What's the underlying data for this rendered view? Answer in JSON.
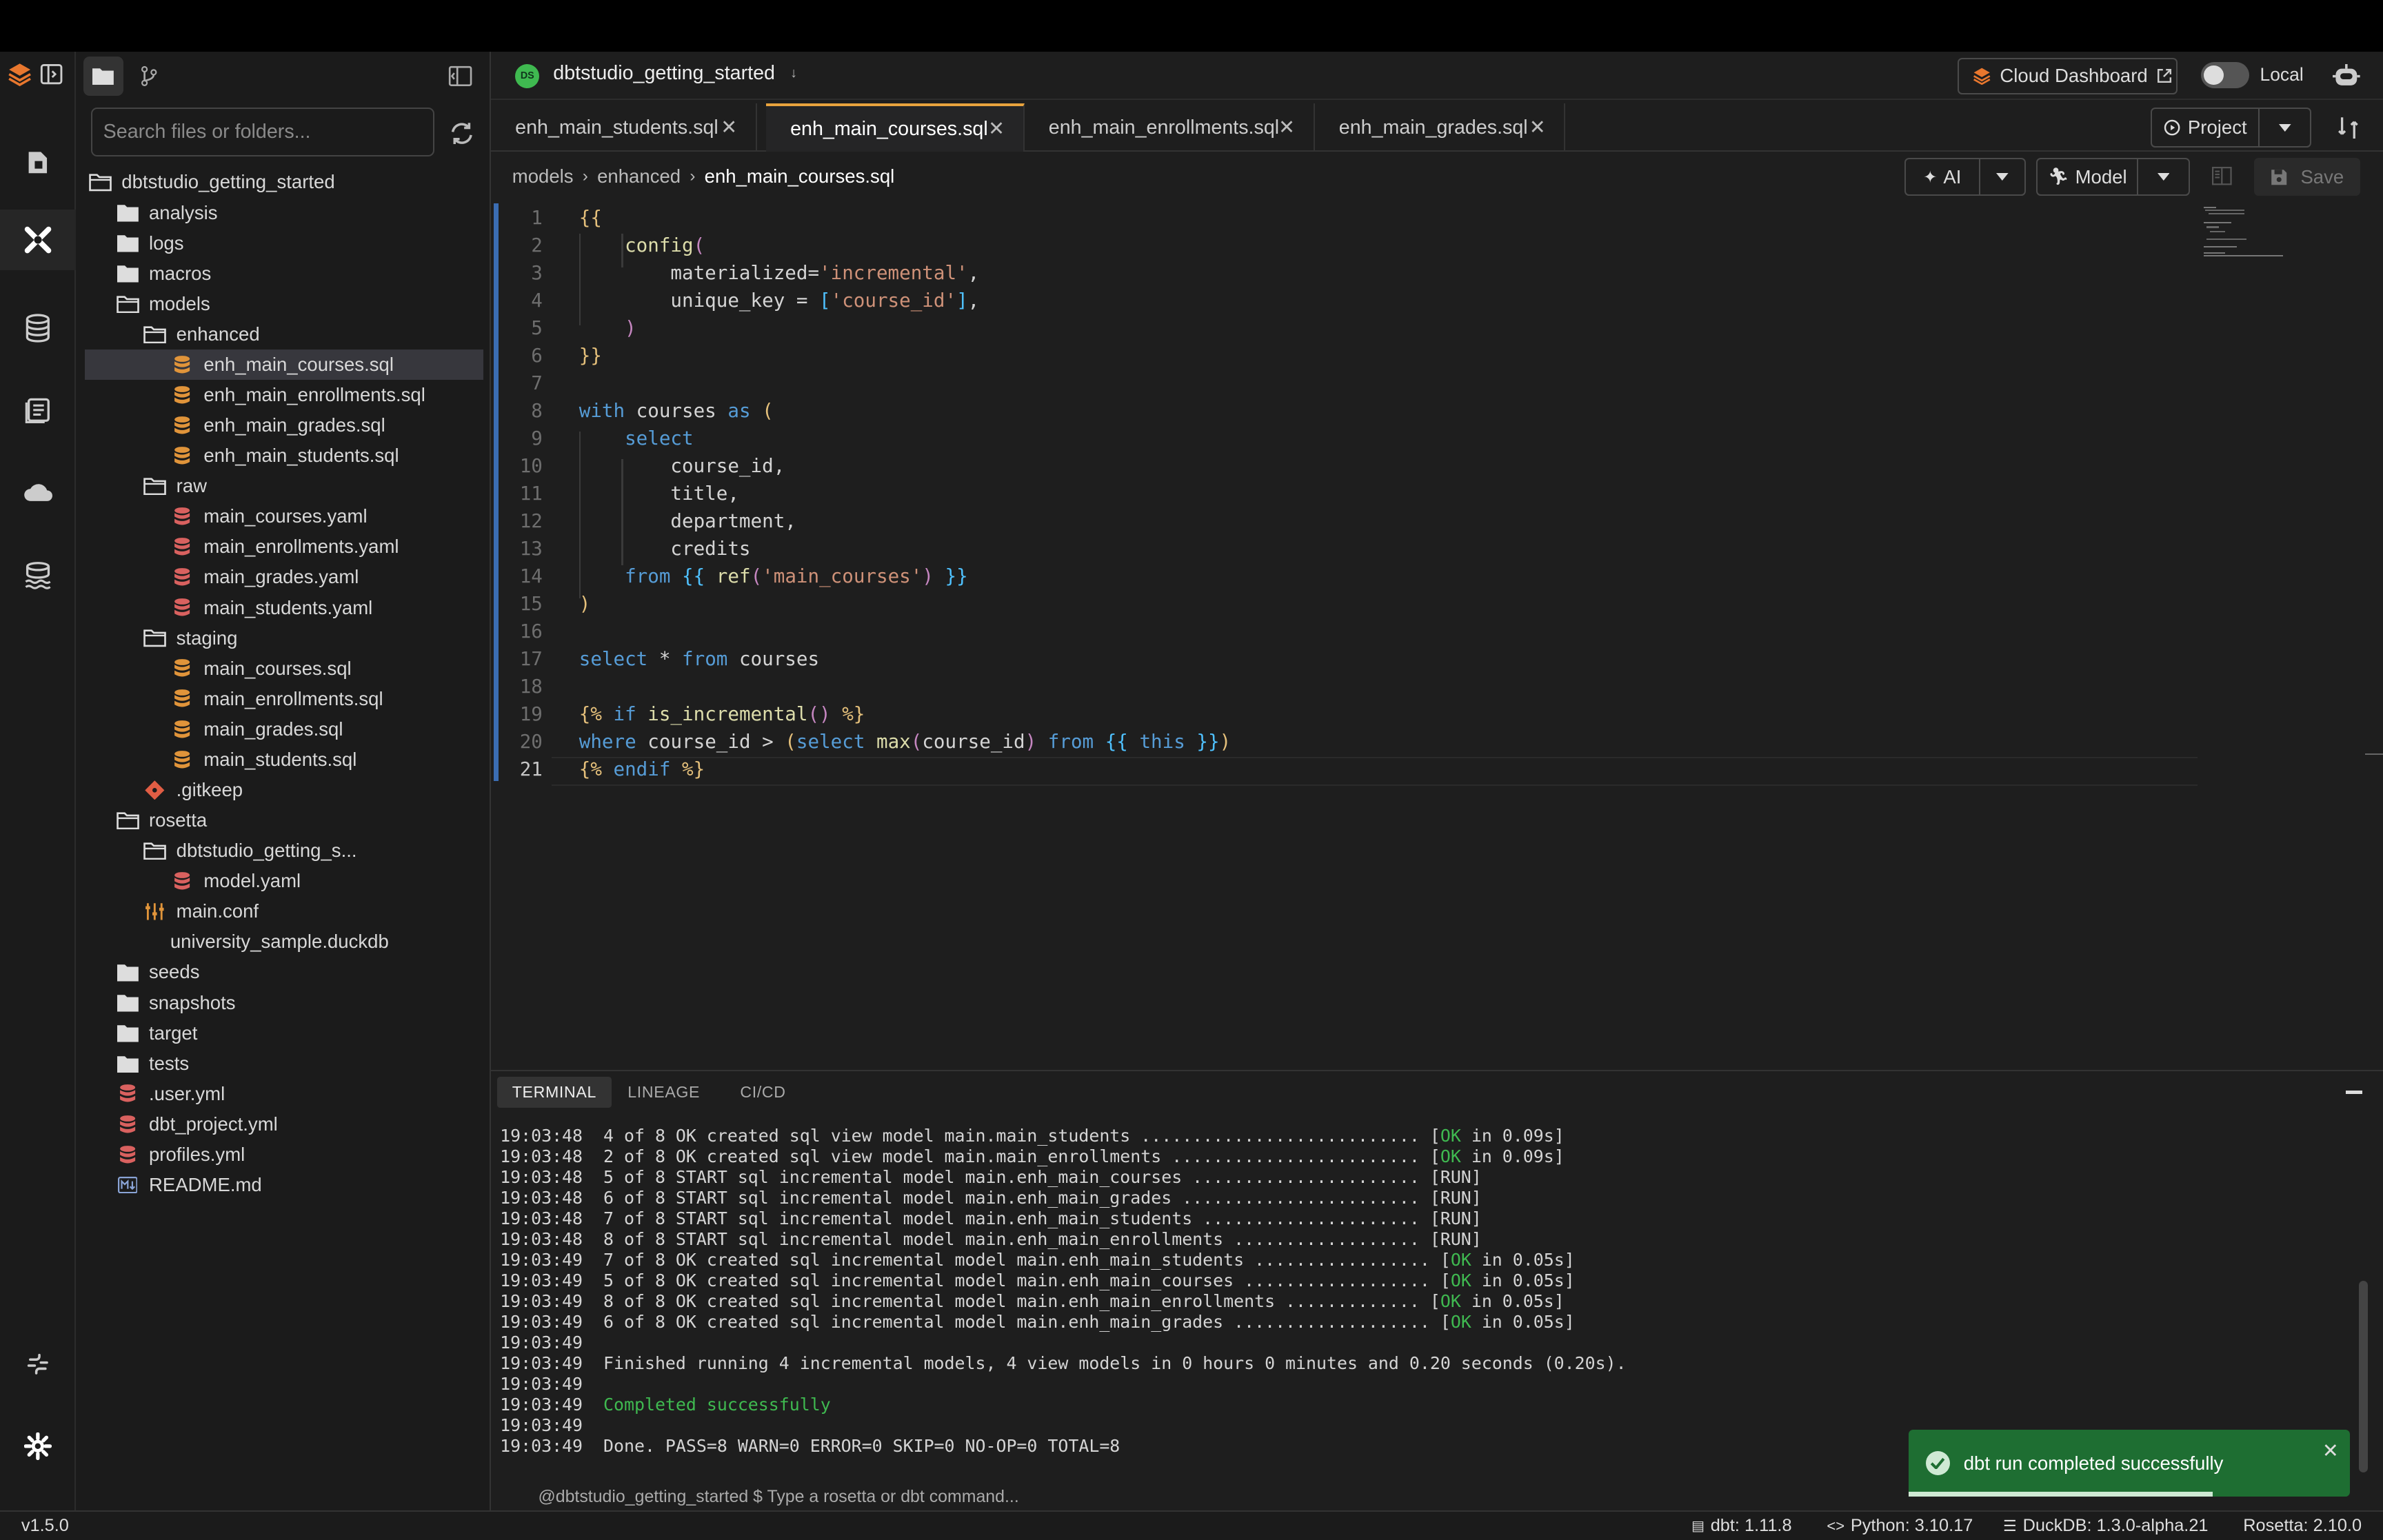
{
  "app": {
    "project_name": "dbtstudio_getting_started",
    "project_badge": "DS",
    "cloud_dashboard": "Cloud Dashboard",
    "env_toggle_label": "Local",
    "version": "v1.5.0"
  },
  "explorer": {
    "search_placeholder": "Search files or folders...",
    "tree": [
      {
        "label": "dbtstudio_getting_started",
        "type": "folder-open",
        "depth": 0
      },
      {
        "label": "analysis",
        "type": "folder",
        "depth": 1
      },
      {
        "label": "logs",
        "type": "folder",
        "depth": 1
      },
      {
        "label": "macros",
        "type": "folder",
        "depth": 1
      },
      {
        "label": "models",
        "type": "folder-open",
        "depth": 1
      },
      {
        "label": "enhanced",
        "type": "folder-open",
        "depth": 2
      },
      {
        "label": "enh_main_courses.sql",
        "type": "sql",
        "depth": 3,
        "selected": true
      },
      {
        "label": "enh_main_enrollments.sql",
        "type": "sql",
        "depth": 3
      },
      {
        "label": "enh_main_grades.sql",
        "type": "sql",
        "depth": 3
      },
      {
        "label": "enh_main_students.sql",
        "type": "sql",
        "depth": 3
      },
      {
        "label": "raw",
        "type": "folder-open",
        "depth": 2
      },
      {
        "label": "main_courses.yaml",
        "type": "yaml",
        "depth": 3
      },
      {
        "label": "main_enrollments.yaml",
        "type": "yaml",
        "depth": 3
      },
      {
        "label": "main_grades.yaml",
        "type": "yaml",
        "depth": 3
      },
      {
        "label": "main_students.yaml",
        "type": "yaml",
        "depth": 3
      },
      {
        "label": "staging",
        "type": "folder-open",
        "depth": 2
      },
      {
        "label": "main_courses.sql",
        "type": "sql",
        "depth": 3
      },
      {
        "label": "main_enrollments.sql",
        "type": "sql",
        "depth": 3
      },
      {
        "label": "main_grades.sql",
        "type": "sql",
        "depth": 3
      },
      {
        "label": "main_students.sql",
        "type": "sql",
        "depth": 3
      },
      {
        "label": ".gitkeep",
        "type": "git",
        "depth": 2
      },
      {
        "label": "rosetta",
        "type": "folder-open",
        "depth": 1
      },
      {
        "label": "dbtstudio_getting_s...",
        "type": "folder-open",
        "depth": 2
      },
      {
        "label": "model.yaml",
        "type": "yaml",
        "depth": 3
      },
      {
        "label": "main.conf",
        "type": "conf",
        "depth": 2
      },
      {
        "label": "university_sample.duckdb",
        "type": "plain",
        "depth": 2
      },
      {
        "label": "seeds",
        "type": "folder",
        "depth": 1
      },
      {
        "label": "snapshots",
        "type": "folder",
        "depth": 1
      },
      {
        "label": "target",
        "type": "folder",
        "depth": 1
      },
      {
        "label": "tests",
        "type": "folder",
        "depth": 1
      },
      {
        "label": ".user.yml",
        "type": "yaml",
        "depth": 1
      },
      {
        "label": "dbt_project.yml",
        "type": "yaml",
        "depth": 1
      },
      {
        "label": "profiles.yml",
        "type": "yaml",
        "depth": 1
      },
      {
        "label": "README.md",
        "type": "md",
        "depth": 1
      }
    ]
  },
  "tabs": [
    {
      "label": "enh_main_students.sql",
      "active": false
    },
    {
      "label": "enh_main_courses.sql",
      "active": true
    },
    {
      "label": "enh_main_enrollments.sql",
      "active": false
    },
    {
      "label": "enh_main_grades.sql",
      "active": false
    }
  ],
  "toolbar": {
    "project": "Project",
    "ai": "AI",
    "model": "Model",
    "save": "Save"
  },
  "breadcrumb": [
    "models",
    "enhanced",
    "enh_main_courses.sql"
  ],
  "editor": {
    "lines": [
      [
        [
          "{{",
          "br"
        ]
      ],
      [
        [
          "    ",
          ""
        ],
        [
          "config",
          "fn"
        ],
        [
          "(",
          "br2"
        ]
      ],
      [
        [
          "        materialized=",
          "pl"
        ],
        [
          "'incremental'",
          "st"
        ],
        [
          ",",
          "pl"
        ]
      ],
      [
        [
          "        unique_key = ",
          "pl"
        ],
        [
          "[",
          "br3"
        ],
        [
          "'course_id'",
          "st"
        ],
        [
          "]",
          "br3"
        ],
        [
          ",",
          "pl"
        ]
      ],
      [
        [
          "    ",
          ""
        ],
        [
          ")",
          "br2"
        ]
      ],
      [
        [
          "}}",
          "br"
        ]
      ],
      [],
      [
        [
          "with",
          "kw"
        ],
        [
          " courses ",
          "pl"
        ],
        [
          "as",
          "kw"
        ],
        [
          " (",
          "br"
        ]
      ],
      [
        [
          "    ",
          ""
        ],
        [
          "select",
          "kw"
        ]
      ],
      [
        [
          "        course_id,",
          "pl"
        ]
      ],
      [
        [
          "        title,",
          "pl"
        ]
      ],
      [
        [
          "        department,",
          "pl"
        ]
      ],
      [
        [
          "        credits",
          "pl"
        ]
      ],
      [
        [
          "    ",
          ""
        ],
        [
          "from",
          "kw"
        ],
        [
          " ",
          ""
        ],
        [
          "{{",
          "br3"
        ],
        [
          " ",
          ""
        ],
        [
          "ref",
          "fn"
        ],
        [
          "(",
          "br2"
        ],
        [
          "'main_courses'",
          "st"
        ],
        [
          ")",
          "br2"
        ],
        [
          " ",
          ""
        ],
        [
          "}}",
          "br3"
        ]
      ],
      [
        [
          ")",
          "br"
        ]
      ],
      [],
      [
        [
          "select",
          "kw"
        ],
        [
          " * ",
          "pl"
        ],
        [
          "from",
          "kw"
        ],
        [
          " courses",
          "pl"
        ]
      ],
      [],
      [
        [
          "{%",
          "br"
        ],
        [
          " if ",
          "kw"
        ],
        [
          "is_incremental",
          "fn"
        ],
        [
          "()",
          "br2"
        ],
        [
          " %}",
          "br"
        ]
      ],
      [
        [
          "where",
          "kw"
        ],
        [
          " course_id > ",
          "pl"
        ],
        [
          "(",
          "br"
        ],
        [
          "select",
          "kw"
        ],
        [
          " max",
          "fn"
        ],
        [
          "(",
          "br2"
        ],
        [
          "course_id",
          "pl"
        ],
        [
          ")",
          "br2"
        ],
        [
          " from ",
          "kw"
        ],
        [
          "{{",
          "br3"
        ],
        [
          " this ",
          "kw"
        ],
        [
          "}}",
          "br3"
        ],
        [
          ")",
          "br"
        ]
      ],
      [
        [
          "{%",
          "br"
        ],
        [
          " endif ",
          "kw"
        ],
        [
          "%}",
          "br"
        ]
      ]
    ]
  },
  "terminal": {
    "tabs": [
      "TERMINAL",
      "LINEAGE",
      "CI/CD"
    ],
    "lines": [
      {
        "time": "19:03:48",
        "text": "4 of 8 OK created sql view model main.main_students ........................... ",
        "status": "OK",
        "tail": " in 0.09s]"
      },
      {
        "time": "19:03:48",
        "text": "2 of 8 OK created sql view model main.main_enrollments ........................ ",
        "status": "OK",
        "tail": " in 0.09s]"
      },
      {
        "time": "19:03:48",
        "text": "5 of 8 START sql incremental model main.enh_main_courses ...................... [RUN]"
      },
      {
        "time": "19:03:48",
        "text": "6 of 8 START sql incremental model main.enh_main_grades ....................... [RUN]"
      },
      {
        "time": "19:03:48",
        "text": "7 of 8 START sql incremental model main.enh_main_students ..................... [RUN]"
      },
      {
        "time": "19:03:48",
        "text": "8 of 8 START sql incremental model main.enh_main_enrollments .................. [RUN]"
      },
      {
        "time": "19:03:49",
        "text": "7 of 8 OK created sql incremental model main.enh_main_students ................. ",
        "status": "OK",
        "tail": " in 0.05s]"
      },
      {
        "time": "19:03:49",
        "text": "5 of 8 OK created sql incremental model main.enh_main_courses .................. ",
        "status": "OK",
        "tail": " in 0.05s]"
      },
      {
        "time": "19:03:49",
        "text": "8 of 8 OK created sql incremental model main.enh_main_enrollments ............. ",
        "status": "OK",
        "tail": " in 0.05s]"
      },
      {
        "time": "19:03:49",
        "text": "6 of 8 OK created sql incremental model main.enh_main_grades ................... ",
        "status": "OK",
        "tail": " in 0.05s]"
      },
      {
        "time": "19:03:49",
        "text": ""
      },
      {
        "time": "19:03:49",
        "text": "Finished running 4 incremental models, 4 view models in 0 hours 0 minutes and 0.20 seconds (0.20s)."
      },
      {
        "time": "19:03:49",
        "text": ""
      },
      {
        "time": "19:03:49",
        "text": "Completed successfully",
        "green": true
      },
      {
        "time": "19:03:49",
        "text": ""
      },
      {
        "time": "19:03:49",
        "text": "Done. PASS=8 WARN=0 ERROR=0 SKIP=0 NO-OP=0 TOTAL=8"
      }
    ],
    "prompt": "@dbtstudio_getting_started $",
    "input_placeholder": "Type a rosetta or dbt command..."
  },
  "toast": {
    "message": "dbt run completed successfully"
  },
  "statusbar": {
    "dbt": "dbt: 1.11.8",
    "python": "Python: 3.10.17",
    "duckdb": "DuckDB: 1.3.0-alpha.21",
    "rosetta": "Rosetta: 2.10.0"
  },
  "colors": {
    "accent": "#e8a33d",
    "toast": "#1e6e32",
    "ok": "#3fb950"
  }
}
